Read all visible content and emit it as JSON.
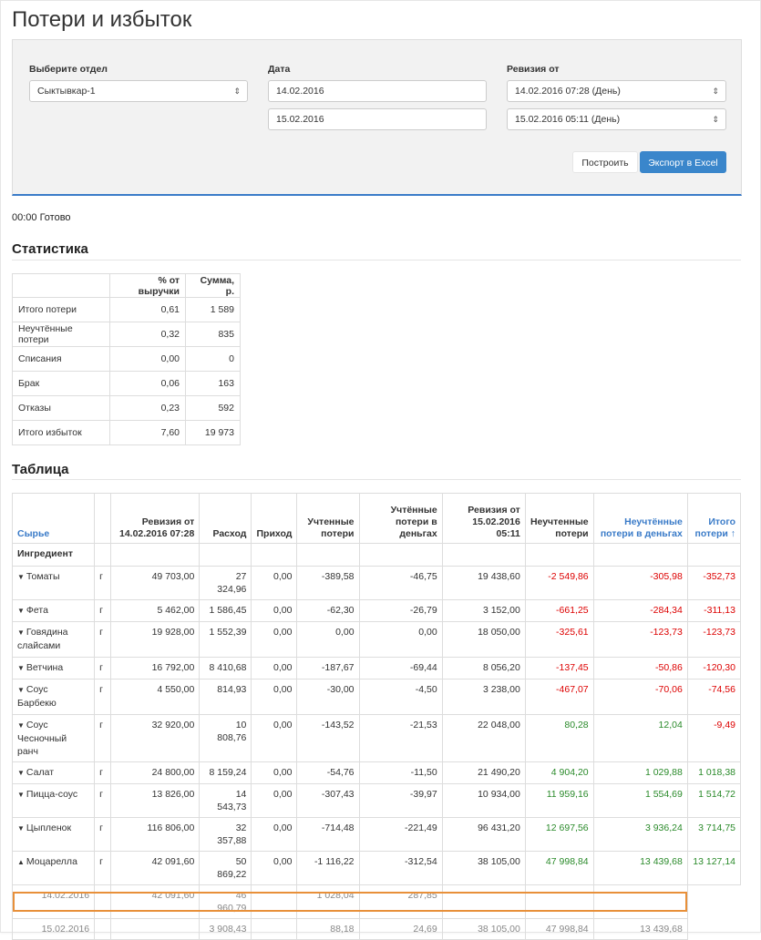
{
  "title": "Потери и избыток",
  "filters": {
    "dept_label": "Выберите отдел",
    "dept_value": "Сыктывкар-1",
    "date_label": "Дата",
    "date_from": "14.02.2016",
    "date_to": "15.02.2016",
    "rev_label": "Ревизия от",
    "rev_from": "14.02.2016 07:28 (День)",
    "rev_to": "15.02.2016 05:11 (День)",
    "build_label": "Построить",
    "export_label": "Экспорт в Excel",
    "arrow": "⇕"
  },
  "status": "00:00 Готово",
  "stats": {
    "heading": "Статистика",
    "col_pct": "% от выручки",
    "col_sum": "Сумма, р.",
    "rows": [
      {
        "name": "Итого потери",
        "pct": "0,61",
        "sum": "1 589"
      },
      {
        "name": "Неучтённые потери",
        "pct": "0,32",
        "sum": "835"
      },
      {
        "name": "Списания",
        "pct": "0,00",
        "sum": "0"
      },
      {
        "name": "Брак",
        "pct": "0,06",
        "sum": "163"
      },
      {
        "name": "Отказы",
        "pct": "0,23",
        "sum": "592"
      },
      {
        "name": "Итого избыток",
        "pct": "7,60",
        "sum": "19 973"
      }
    ]
  },
  "table": {
    "heading": "Таблица",
    "headers": {
      "raw": "Сырье",
      "rev_from": "Ревизия от 14.02.2016 07:28",
      "expense": "Расход",
      "income": "Приход",
      "counted_loss": "Учтенные потери",
      "counted_money": "Учтённые потери в деньгах",
      "rev_to": "Ревизия от 15.02.2016 05:11",
      "uncounted_loss": "Неучтенные потери",
      "uncounted_money": "Неучтённые потери в деньгах",
      "total_loss": "Итого потери ↑"
    },
    "group_label": "Ингредиент",
    "rows": [
      {
        "name": "Томаты",
        "open": false,
        "unit": "г",
        "rev_from": "49 703,00",
        "expense": "27 324,96",
        "income": "0,00",
        "counted_loss": "-389,58",
        "counted_money": "-46,75",
        "rev_to": "19 438,60",
        "uncounted_loss": "-2 549,86",
        "uncounted_money": "-305,98",
        "total_loss": "-352,73",
        "sign": "neg"
      },
      {
        "name": "Фета",
        "open": false,
        "unit": "г",
        "rev_from": "5 462,00",
        "expense": "1 586,45",
        "income": "0,00",
        "counted_loss": "-62,30",
        "counted_money": "-26,79",
        "rev_to": "3 152,00",
        "uncounted_loss": "-661,25",
        "uncounted_money": "-284,34",
        "total_loss": "-311,13",
        "sign": "neg"
      },
      {
        "name": "Говядина слайсами",
        "open": false,
        "unit": "г",
        "rev_from": "19 928,00",
        "expense": "1 552,39",
        "income": "0,00",
        "counted_loss": "0,00",
        "counted_money": "0,00",
        "rev_to": "18 050,00",
        "uncounted_loss": "-325,61",
        "uncounted_money": "-123,73",
        "total_loss": "-123,73",
        "sign": "neg"
      },
      {
        "name": "Ветчина",
        "open": false,
        "unit": "г",
        "rev_from": "16 792,00",
        "expense": "8 410,68",
        "income": "0,00",
        "counted_loss": "-187,67",
        "counted_money": "-69,44",
        "rev_to": "8 056,20",
        "uncounted_loss": "-137,45",
        "uncounted_money": "-50,86",
        "total_loss": "-120,30",
        "sign": "neg"
      },
      {
        "name": "Соус Барбекю",
        "open": false,
        "unit": "г",
        "rev_from": "4 550,00",
        "expense": "814,93",
        "income": "0,00",
        "counted_loss": "-30,00",
        "counted_money": "-4,50",
        "rev_to": "3 238,00",
        "uncounted_loss": "-467,07",
        "uncounted_money": "-70,06",
        "total_loss": "-74,56",
        "sign": "neg"
      },
      {
        "name": "Соус Чесночный ранч",
        "open": false,
        "unit": "г",
        "rev_from": "32 920,00",
        "expense": "10 808,76",
        "income": "0,00",
        "counted_loss": "-143,52",
        "counted_money": "-21,53",
        "rev_to": "22 048,00",
        "uncounted_loss": "80,28",
        "uncounted_money": "12,04",
        "total_loss": "-9,49",
        "sign": "pos"
      },
      {
        "name": "Салат",
        "open": false,
        "unit": "г",
        "rev_from": "24 800,00",
        "expense": "8 159,24",
        "income": "0,00",
        "counted_loss": "-54,76",
        "counted_money": "-11,50",
        "rev_to": "21 490,20",
        "uncounted_loss": "4 904,20",
        "uncounted_money": "1 029,88",
        "total_loss": "1 018,38",
        "sign": "pos"
      },
      {
        "name": "Пицца-соус",
        "open": false,
        "unit": "г",
        "rev_from": "13 826,00",
        "expense": "14 543,73",
        "income": "0,00",
        "counted_loss": "-307,43",
        "counted_money": "-39,97",
        "rev_to": "10 934,00",
        "uncounted_loss": "11 959,16",
        "uncounted_money": "1 554,69",
        "total_loss": "1 514,72",
        "sign": "pos"
      },
      {
        "name": "Цыпленок",
        "open": false,
        "unit": "г",
        "rev_from": "116 806,00",
        "expense": "32 357,88",
        "income": "0,00",
        "counted_loss": "-714,48",
        "counted_money": "-221,49",
        "rev_to": "96 431,20",
        "uncounted_loss": "12 697,56",
        "uncounted_money": "3 936,24",
        "total_loss": "3 714,75",
        "sign": "pos"
      },
      {
        "name": "Моцарелла",
        "open": true,
        "unit": "г",
        "rev_from": "42 091,60",
        "expense": "50 869,22",
        "income": "0,00",
        "counted_loss": "-1 116,22",
        "counted_money": "-312,54",
        "rev_to": "38 105,00",
        "uncounted_loss": "47 998,84",
        "uncounted_money": "13 439,68",
        "total_loss": "13 127,14",
        "sign": "pos"
      }
    ],
    "sub_rows": [
      {
        "date": "14.02.2016",
        "rev_from": "42 091,60",
        "expense": "46 960,79",
        "counted_loss": "1 028,04",
        "counted_money": "287,85",
        "rev_to": "",
        "uncounted_loss": "",
        "uncounted_money": ""
      },
      {
        "date": "15.02.2016",
        "rev_from": "",
        "expense": "3 908,43",
        "counted_loss": "88,18",
        "counted_money": "24,69",
        "rev_to": "38 105,00",
        "uncounted_loss": "47 998,84",
        "uncounted_money": "13 439,68"
      }
    ]
  },
  "colors": {
    "accent": "#3a86cb",
    "negative": "#dd0000",
    "positive": "#2a8a2a",
    "highlight": "#e8903a"
  }
}
